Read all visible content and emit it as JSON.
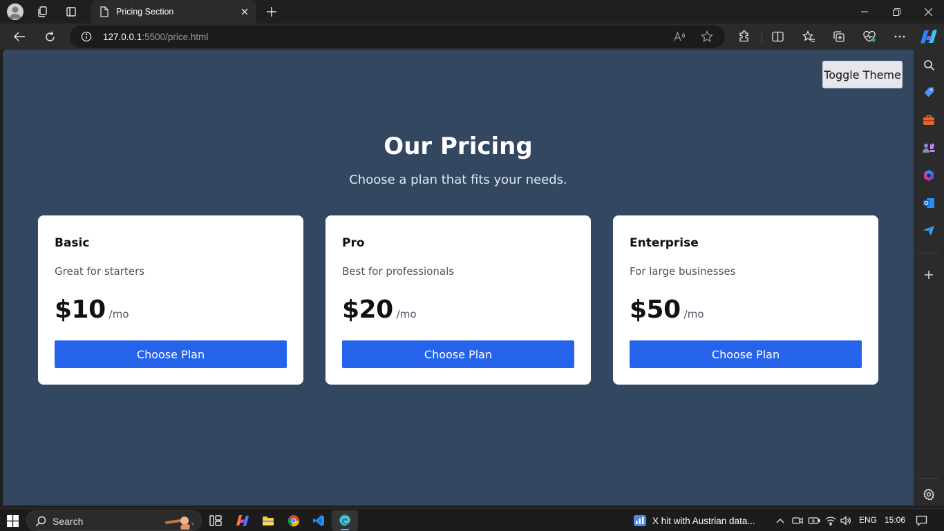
{
  "browser": {
    "tab_title": "Pricing Section",
    "url_host": "127.0.0.1",
    "url_rest": ":5500/price.html"
  },
  "page": {
    "toggle_label": "Toggle Theme",
    "heading": "Our Pricing",
    "subheading": "Choose a plan that fits your needs.",
    "plans": [
      {
        "name": "Basic",
        "description": "Great for starters",
        "price": "$10",
        "period": "/mo",
        "button": "Choose Plan"
      },
      {
        "name": "Pro",
        "description": "Best for professionals",
        "price": "$20",
        "period": "/mo",
        "button": "Choose Plan"
      },
      {
        "name": "Enterprise",
        "description": "For large businesses",
        "price": "$50",
        "period": "/mo",
        "button": "Choose Plan"
      }
    ],
    "colors": {
      "background": "#334761",
      "card": "#ffffff",
      "button": "#2563eb"
    }
  },
  "taskbar": {
    "search_label": "Search",
    "news_text": "X hit with Austrian data...",
    "language": "ENG",
    "time": "15:06"
  },
  "icons": {
    "tabbar": [
      "profile-avatar",
      "workspaces-icon",
      "tab-actions-icon",
      "page-icon",
      "close-icon",
      "new-tab-icon",
      "minimize-icon",
      "restore-icon",
      "close-window-icon"
    ],
    "toolbar": [
      "back-icon",
      "refresh-icon",
      "info-icon",
      "read-aloud-icon",
      "favorite-star-icon",
      "extensions-icon",
      "split-screen-icon",
      "favorites-icon",
      "collections-icon",
      "browser-essentials-icon",
      "more-icon",
      "copilot-icon"
    ],
    "sidebar": [
      "search-icon",
      "shopping-tag-icon",
      "tools-icon",
      "games-icon",
      "microsoft-365-icon",
      "outlook-icon",
      "send-icon",
      "add-icon",
      "settings-icon"
    ]
  }
}
